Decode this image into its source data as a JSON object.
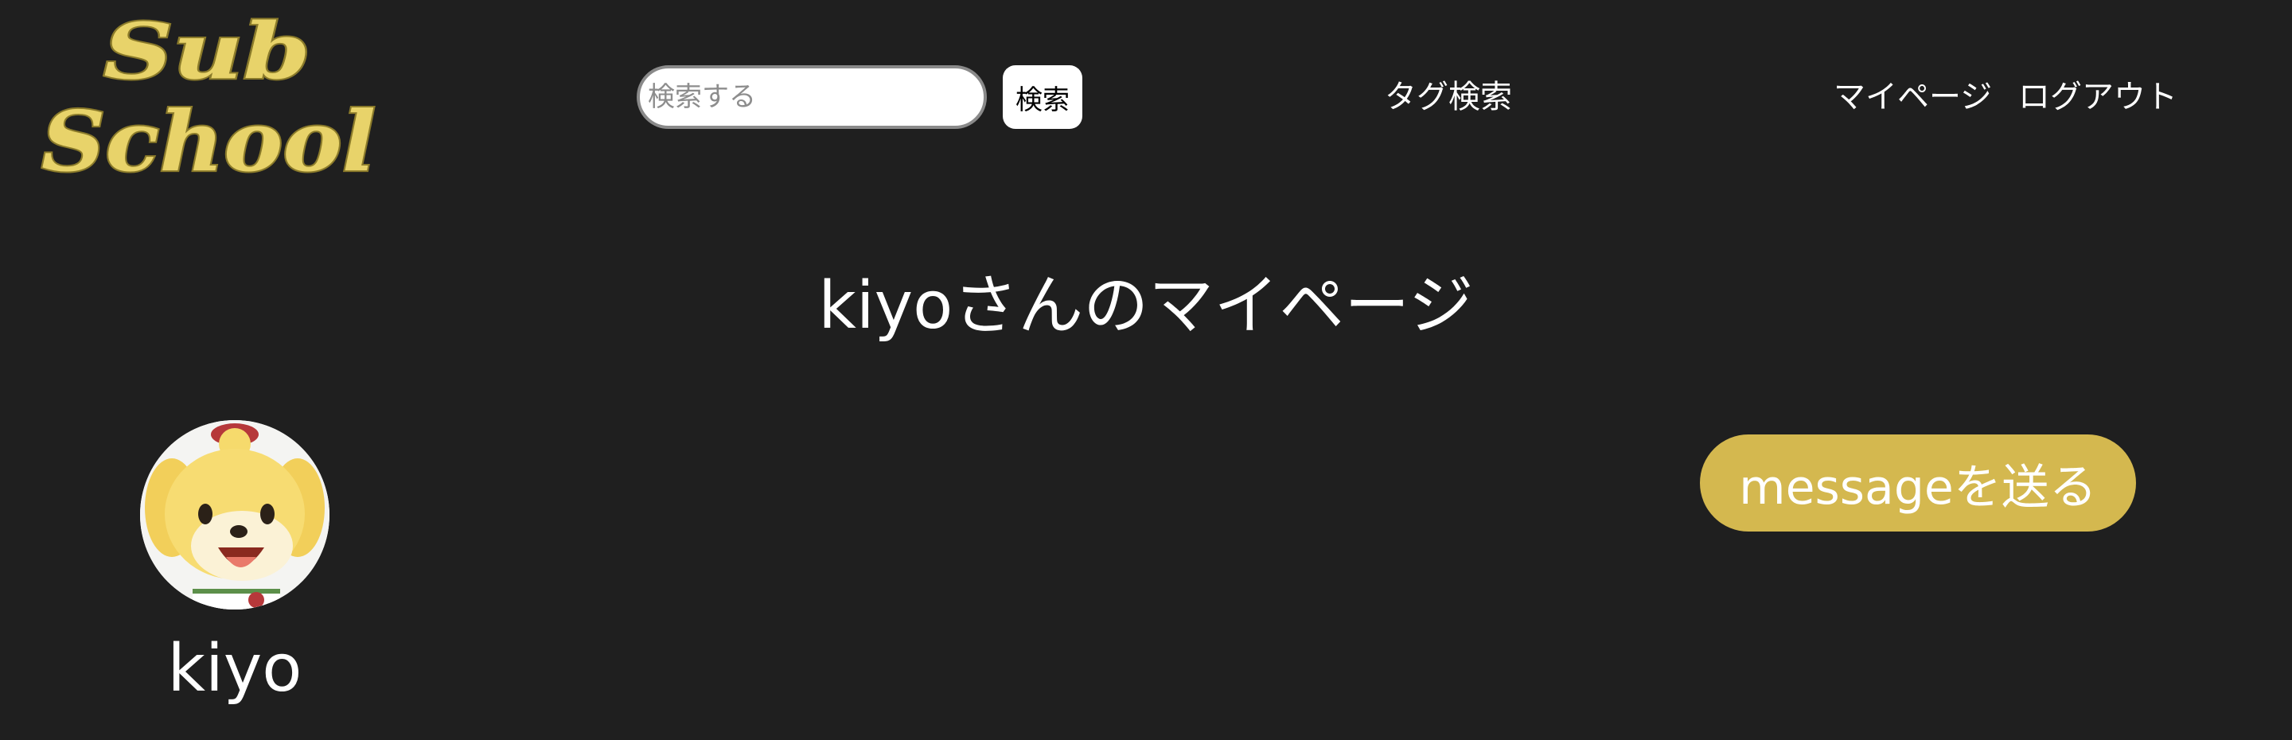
{
  "header": {
    "logo": {
      "line1": "Sub",
      "line2": "School",
      "color": "#e8d36a"
    },
    "search": {
      "placeholder": "検索する",
      "button_label": "検索"
    },
    "nav": {
      "tag_search": "タグ検索",
      "mypage": "マイページ",
      "logout": "ログアウト"
    }
  },
  "main": {
    "title": "kiyoさんのマイページ",
    "profile": {
      "username": "kiyo",
      "avatar_icon": "dog-character-avatar"
    },
    "message_button_label": "messageを送る",
    "accent_color": "#d4b84f"
  }
}
